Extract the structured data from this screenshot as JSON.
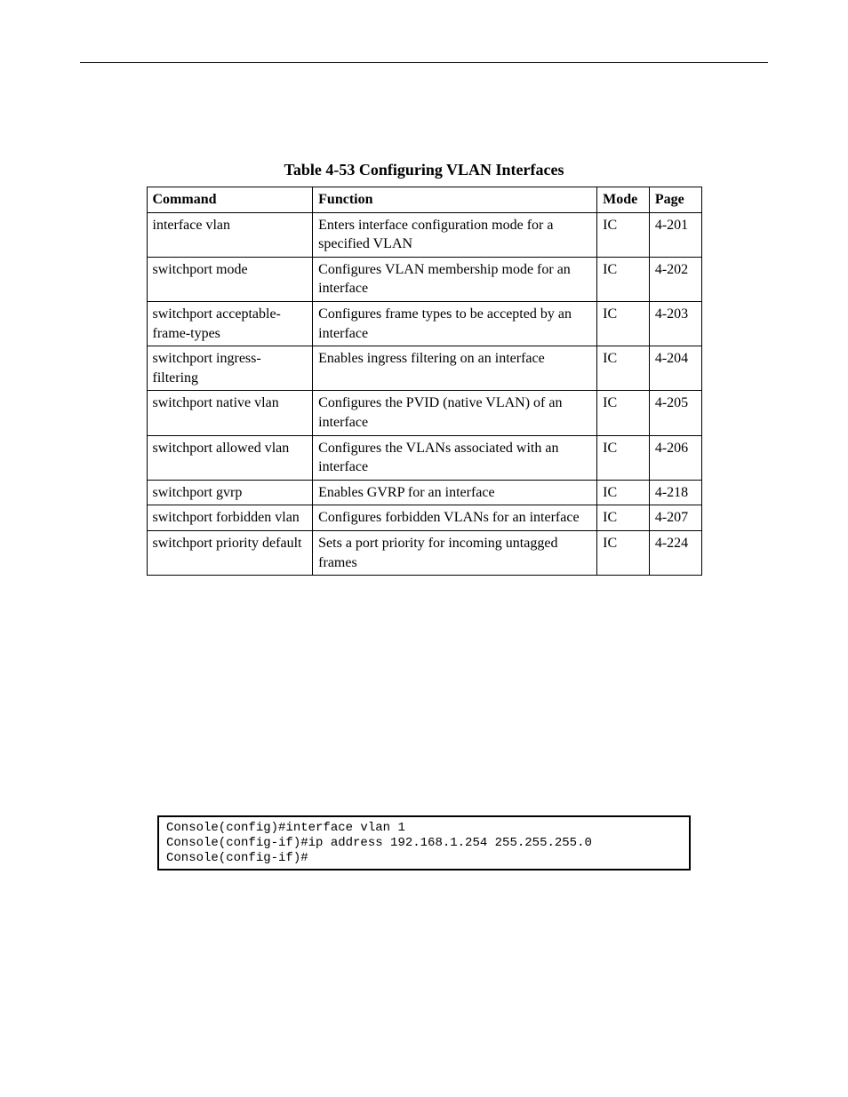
{
  "caption": "Table 4-53 Configuring VLAN Interfaces",
  "headers": {
    "c1": "Command",
    "c2": "Function",
    "c3": "Mode",
    "c4": "Page"
  },
  "rows": [
    {
      "cmd": "interface vlan",
      "func": "Enters interface configuration mode for a specified VLAN",
      "mode": "IC",
      "page": "4-201"
    },
    {
      "cmd": "switchport mode",
      "func": "Configures VLAN membership mode for an interface",
      "mode": "IC",
      "page": "4-202"
    },
    {
      "cmd": "switchport acceptable-frame-types",
      "func": "Configures frame types to be accepted by an interface",
      "mode": "IC",
      "page": "4-203"
    },
    {
      "cmd": "switchport ingress-filtering",
      "func": "Enables ingress filtering on an interface",
      "mode": "IC",
      "page": "4-204"
    },
    {
      "cmd": "switchport native vlan",
      "func": "Configures the PVID (native VLAN) of an interface",
      "mode": "IC",
      "page": "4-205"
    },
    {
      "cmd": "switchport allowed vlan",
      "func": "Configures the VLANs associated with an interface",
      "mode": "IC",
      "page": "4-206"
    },
    {
      "cmd": "switchport gvrp",
      "func": "Enables GVRP for an interface",
      "mode": "IC",
      "page": "4-218"
    },
    {
      "cmd": "switchport forbidden vlan",
      "func": "Configures forbidden VLANs for an interface",
      "mode": "IC",
      "page": "4-207"
    },
    {
      "cmd": "switchport priority default",
      "func": "Sets a port priority for incoming untagged frames",
      "mode": "IC",
      "page": "4-224"
    }
  ],
  "console": "Console(config)#interface vlan 1\nConsole(config-if)#ip address 192.168.1.254 255.255.255.0\nConsole(config-if)#"
}
